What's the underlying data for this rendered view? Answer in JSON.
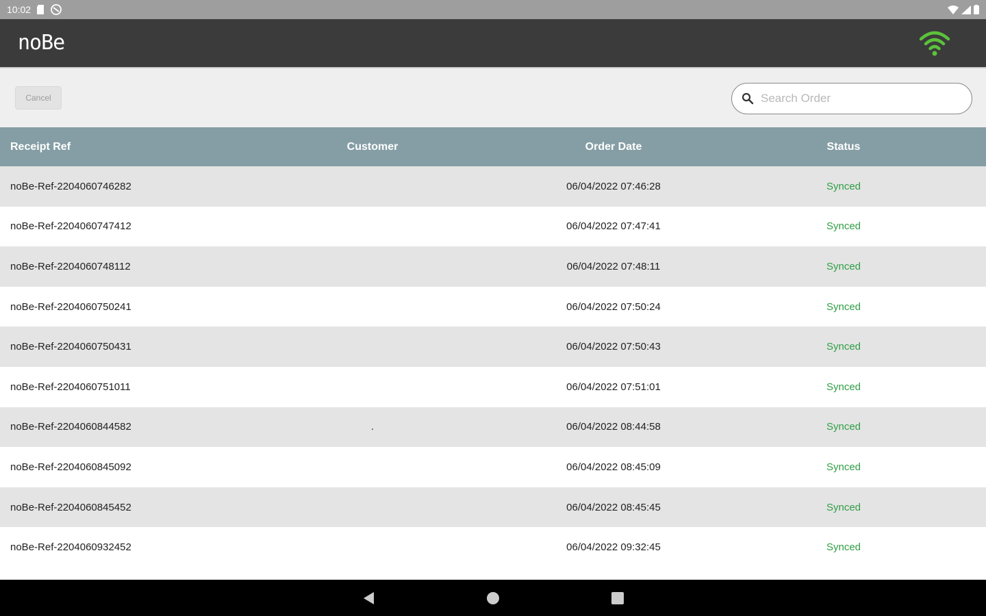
{
  "status_bar": {
    "time": "10:02"
  },
  "app": {
    "logo_text": "noBe",
    "wifi_color": "#5cc13b"
  },
  "toolbar": {
    "cancel_label": "Cancel",
    "search_placeholder": "Search Order"
  },
  "table": {
    "headers": {
      "receipt_ref": "Receipt Ref",
      "customer": "Customer",
      "order_date": "Order Date",
      "status": "Status"
    },
    "rows": [
      {
        "ref": "noBe-Ref-2204060746282",
        "customer": "",
        "date": "06/04/2022 07:46:28",
        "status": "Synced"
      },
      {
        "ref": "noBe-Ref-2204060747412",
        "customer": "",
        "date": "06/04/2022 07:47:41",
        "status": "Synced"
      },
      {
        "ref": "noBe-Ref-2204060748112",
        "customer": "",
        "date": "06/04/2022 07:48:11",
        "status": "Synced"
      },
      {
        "ref": "noBe-Ref-2204060750241",
        "customer": "",
        "date": "06/04/2022 07:50:24",
        "status": "Synced"
      },
      {
        "ref": "noBe-Ref-2204060750431",
        "customer": "",
        "date": "06/04/2022 07:50:43",
        "status": "Synced"
      },
      {
        "ref": "noBe-Ref-2204060751011",
        "customer": "",
        "date": "06/04/2022 07:51:01",
        "status": "Synced"
      },
      {
        "ref": "noBe-Ref-2204060844582",
        "customer": ".",
        "date": "06/04/2022 08:44:58",
        "status": "Synced"
      },
      {
        "ref": "noBe-Ref-2204060845092",
        "customer": "",
        "date": "06/04/2022 08:45:09",
        "status": "Synced"
      },
      {
        "ref": "noBe-Ref-2204060845452",
        "customer": "",
        "date": "06/04/2022 08:45:45",
        "status": "Synced"
      },
      {
        "ref": "noBe-Ref-2204060932452",
        "customer": "",
        "date": "06/04/2022 09:32:45",
        "status": "Synced"
      }
    ]
  },
  "colors": {
    "header_bg": "#859ea5",
    "status_synced": "#2f9e44",
    "app_bar": "#3b3b3b"
  }
}
